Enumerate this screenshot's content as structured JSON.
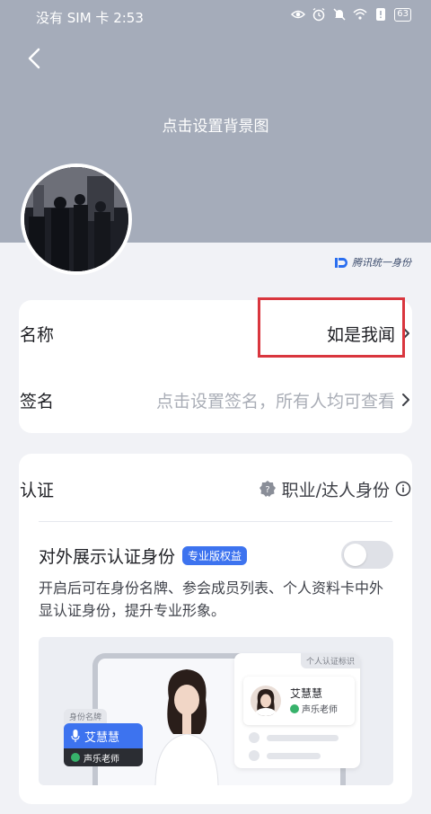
{
  "status_bar": {
    "carrier_time": "没有 SIM 卡 2:53",
    "battery": "63"
  },
  "header": {
    "bg_hint": "点击设置背景图",
    "tencent_id_label": "腾讯统一身份"
  },
  "profile": {
    "name_label": "名称",
    "name_value": "如是我闻",
    "signature_label": "签名",
    "signature_placeholder": "点击设置签名，所有人均可查看"
  },
  "certification": {
    "label": "认证",
    "value": "职业/达人身份",
    "show_title": "对外展示认证身份",
    "pro_badge": "专业版权益",
    "toggle_on": false,
    "description": "开启后可在身份名牌、参会成员列表、个人资料卡中外显认证身份，提升专业形象。"
  },
  "preview": {
    "card_tag": "个人认证标识",
    "person_name": "艾慧慧",
    "person_role": "声乐老师",
    "badge_tag": "身份名牌",
    "badge_name": "艾慧慧",
    "badge_role": "声乐老师"
  },
  "colors": {
    "header_bg": "#a5acba",
    "accent_blue": "#3d73ef",
    "highlight_red": "#d9363e",
    "verified_green": "#37b26b"
  }
}
